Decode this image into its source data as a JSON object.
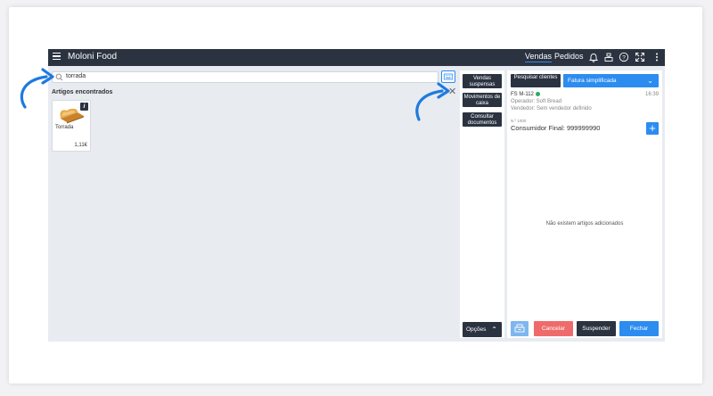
{
  "app": {
    "brand": "Moloni Food",
    "tabs": [
      {
        "label": "Vendas",
        "active": true
      },
      {
        "label": "Pedidos",
        "active": false
      }
    ],
    "icons": [
      "bell-icon",
      "cashier-icon",
      "help-icon",
      "fullscreen-icon",
      "more-icon"
    ]
  },
  "search": {
    "value": "torrada",
    "placeholder": ""
  },
  "articles": {
    "heading": "Artigos encontrados",
    "items": [
      {
        "name": "Torrada",
        "price": "1,11€",
        "info": "i"
      }
    ]
  },
  "actions": {
    "suspended_sales": "Vendas suspensas",
    "cash_movements": "Movimentos de caixa",
    "consult_documents": "Consultar documentos",
    "options": "Opções"
  },
  "sale": {
    "search_clients": "Pesquisar clientes",
    "doc_type": "Fatura simplificada",
    "doc_number": "FS M-112",
    "time": "16:39",
    "operator": "Operador: Soft Bread",
    "seller": "Vendedor: Sem vendedor definido",
    "nif_label": "N.º 1000",
    "customer": "Consumidor Final: 999999990",
    "empty_message": "Não existem artigos adicionados",
    "cancel": "Cancelar",
    "suspend": "Suspender",
    "close": "Fechar"
  },
  "colors": {
    "topbar": "#2b3341",
    "accent": "#2d8cf0",
    "cancel": "#ef6b6b",
    "drawer": "#7fb6ee",
    "status_dot": "#27ae60"
  }
}
